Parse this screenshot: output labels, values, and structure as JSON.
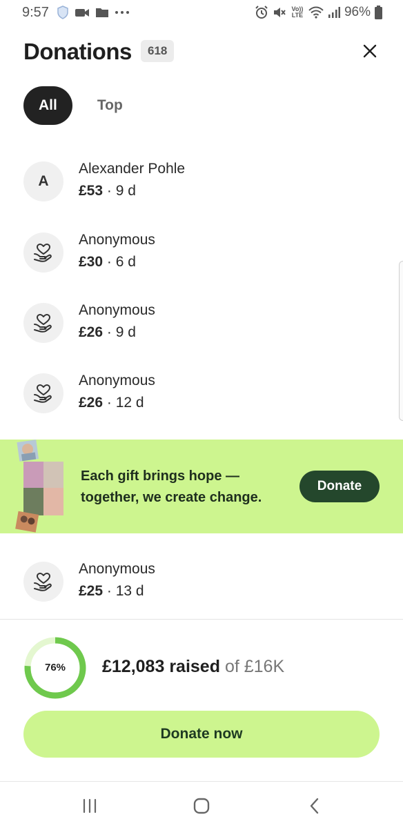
{
  "status_bar": {
    "time": "9:57",
    "battery": "96%",
    "left_icons": [
      "shield-icon",
      "video-icon",
      "folder-icon",
      "more-dots-icon"
    ],
    "right_icons": [
      "alarm-icon",
      "mute-icon",
      "volte-icon",
      "wifi-icon",
      "signal-icon",
      "battery-icon"
    ],
    "volte_label": "Vo)) LTE"
  },
  "header": {
    "title": "Donations",
    "count": "618",
    "close_icon": "close-icon"
  },
  "tabs": [
    {
      "label": "All",
      "active": true
    },
    {
      "label": "Top",
      "active": false
    }
  ],
  "donations": [
    {
      "name": "Alexander Pohle",
      "avatar": "A",
      "amount": "£53",
      "separator": "·",
      "time": "9 d"
    },
    {
      "name": "Anonymous",
      "avatar": "heart-hand-icon",
      "amount": "£30",
      "separator": "·",
      "time": "6 d"
    },
    {
      "name": "Anonymous",
      "avatar": "heart-hand-icon",
      "amount": "£26",
      "separator": "·",
      "time": "9 d"
    },
    {
      "name": "Anonymous",
      "avatar": "heart-hand-icon",
      "amount": "£26",
      "separator": "·",
      "time": "12 d"
    },
    {
      "name": "Anonymous",
      "avatar": "heart-hand-icon",
      "amount": "£25",
      "separator": "·",
      "time": "13 d"
    }
  ],
  "banner": {
    "line1": "Each gift brings hope —",
    "line2": "together, we create change.",
    "button": "Donate",
    "background": "#cdf58f",
    "button_color": "#24472c"
  },
  "progress": {
    "percent_label": "76%",
    "fraction": 0.76,
    "raised": "£12,083 raised",
    "of_goal": "of £16K",
    "ring_color": "#6fc94d"
  },
  "cta": {
    "label": "Donate now",
    "background": "#cdf58f"
  },
  "nav": {
    "icons": [
      "recents-icon",
      "home-icon",
      "back-icon"
    ]
  }
}
